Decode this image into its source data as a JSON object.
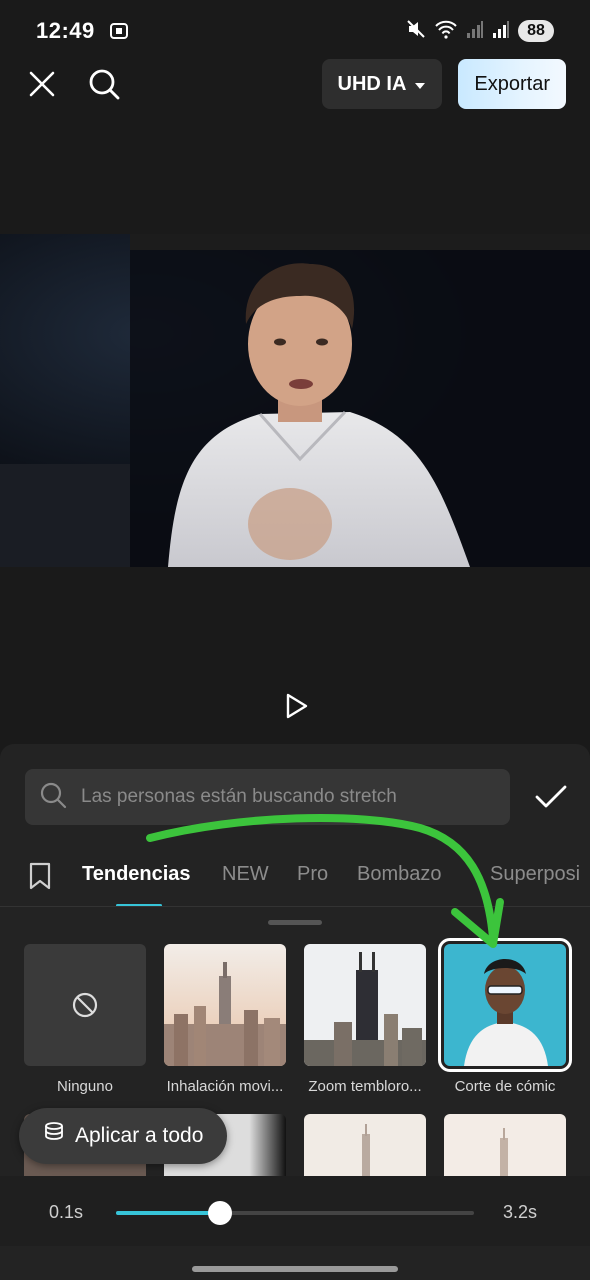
{
  "status_bar": {
    "time": "12:49",
    "battery": "88",
    "icons": [
      "screen-record-icon",
      "mute-icon",
      "wifi-icon",
      "signal-icon",
      "signal-icon"
    ]
  },
  "top_bar": {
    "quality_label": "UHD IA",
    "export_label": "Exportar",
    "icons": [
      "close-icon",
      "search-icon",
      "dropdown-caret-icon"
    ]
  },
  "player": {
    "play_icon": "play-icon"
  },
  "effects_panel": {
    "search_placeholder": "Las personas están buscando stretch",
    "tabs": [
      "Tendencias",
      "NEW",
      "Pro",
      "Bombazos",
      "Superposición"
    ],
    "tabs_visible": [
      "Tendencias",
      "NEW",
      "Pro",
      "Bombazo",
      "Superposi"
    ],
    "active_tab": "Tendencias",
    "effects": [
      {
        "label": "Ninguno"
      },
      {
        "label": "Inhalación movi..."
      },
      {
        "label": "Zoom temblоro..."
      },
      {
        "label": "Corte de cómic"
      }
    ],
    "selected_effect": "Corte de cómic",
    "apply_all_label": "Aplicar a todo",
    "duration": {
      "min_label": "0.1s",
      "max_label": "3.2s",
      "value_fraction": 0.29
    }
  },
  "colors": {
    "accent": "#37c4d8",
    "annotation_arrow": "#3cc43c",
    "background": "#1a1a1a",
    "panel": "#232323"
  }
}
